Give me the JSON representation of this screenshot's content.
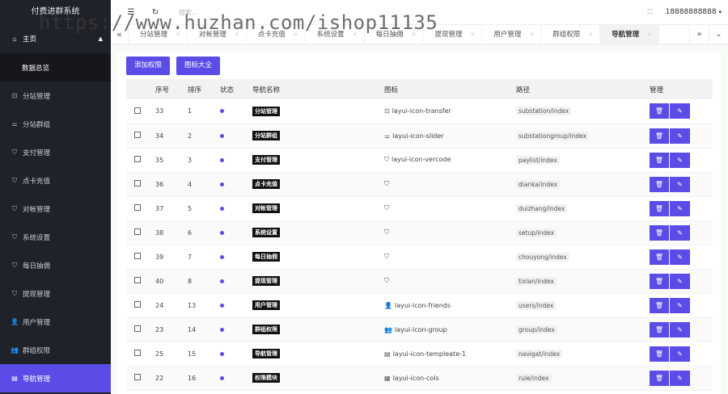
{
  "app": {
    "title": "付费进群系统"
  },
  "sidebar": {
    "items": [
      {
        "label": "主页",
        "icon": "⌂",
        "icon_name": "home-icon",
        "type": "home"
      },
      {
        "label": "数据总览",
        "icon": "",
        "icon_name": "",
        "type": "sub"
      },
      {
        "label": "分站管理",
        "icon": "⊡",
        "icon_name": "transfer-icon",
        "type": "item"
      },
      {
        "label": "分站群组",
        "icon": "⚌",
        "icon_name": "slider-icon",
        "type": "item"
      },
      {
        "label": "支付管理",
        "icon": "⛉",
        "icon_name": "shield-icon",
        "type": "item"
      },
      {
        "label": "点卡充值",
        "icon": "⛉",
        "icon_name": "shield-icon",
        "type": "item"
      },
      {
        "label": "对帐管理",
        "icon": "⛉",
        "icon_name": "shield-icon",
        "type": "item"
      },
      {
        "label": "系统设置",
        "icon": "⛉",
        "icon_name": "shield-icon",
        "type": "item"
      },
      {
        "label": "每日抽佣",
        "icon": "⛉",
        "icon_name": "shield-icon",
        "type": "item"
      },
      {
        "label": "提现管理",
        "icon": "⛉",
        "icon_name": "shield-icon",
        "type": "item"
      },
      {
        "label": "用户管理",
        "icon": "👤",
        "icon_name": "user-icon",
        "type": "item"
      },
      {
        "label": "群组权限",
        "icon": "👥",
        "icon_name": "group-icon",
        "type": "item"
      },
      {
        "label": "导航管理",
        "icon": "▤",
        "icon_name": "template-icon",
        "type": "active"
      }
    ]
  },
  "header": {
    "search_placeholder": "搜索...",
    "phone": "18888888888"
  },
  "watermark": "https://www.huzhan.com/ishop11135",
  "tabs": [
    {
      "label": "分站管理",
      "active": false
    },
    {
      "label": "对帐管理",
      "active": false
    },
    {
      "label": "点卡充值",
      "active": false
    },
    {
      "label": "系统设置",
      "active": false
    },
    {
      "label": "每日抽佣",
      "active": false
    },
    {
      "label": "提现管理",
      "active": false
    },
    {
      "label": "用户管理",
      "active": false
    },
    {
      "label": "群组权限",
      "active": false
    },
    {
      "label": "导航管理",
      "active": true
    }
  ],
  "toolbar": {
    "add_label": "添加权限",
    "icons_label": "图标大全"
  },
  "table": {
    "headers": [
      "",
      "序号",
      "排序",
      "状态",
      "导航名称",
      "图标",
      "路径",
      "管理"
    ],
    "rows": [
      {
        "id": "33",
        "sort": "1",
        "name": "分站管理",
        "icon_glyph": "⊡",
        "icon_name": "transfer-icon",
        "icon_text": "layui-icon-transfer",
        "path": "substation/index"
      },
      {
        "id": "34",
        "sort": "2",
        "name": "分站群组",
        "icon_glyph": "⚌",
        "icon_name": "slider-icon",
        "icon_text": "layui-icon-slider",
        "path": "substationgroup/index"
      },
      {
        "id": "35",
        "sort": "3",
        "name": "支付管理",
        "icon_glyph": "⛉",
        "icon_name": "shield-icon",
        "icon_text": "layui-icon-vercode",
        "path": "paylist/index"
      },
      {
        "id": "36",
        "sort": "4",
        "name": "点卡充值",
        "icon_glyph": "⛉",
        "icon_name": "shield-icon",
        "icon_text": "",
        "path": "dianka/index"
      },
      {
        "id": "37",
        "sort": "5",
        "name": "对帐管理",
        "icon_glyph": "⛉",
        "icon_name": "shield-icon",
        "icon_text": "",
        "path": "duizhang/index"
      },
      {
        "id": "38",
        "sort": "6",
        "name": "系统设置",
        "icon_glyph": "⛉",
        "icon_name": "shield-icon",
        "icon_text": "",
        "path": "setup/index"
      },
      {
        "id": "39",
        "sort": "7",
        "name": "每日抽佣",
        "icon_glyph": "⛉",
        "icon_name": "shield-icon",
        "icon_text": "",
        "path": "chouyong/index"
      },
      {
        "id": "40",
        "sort": "8",
        "name": "提现管理",
        "icon_glyph": "⛉",
        "icon_name": "shield-icon",
        "icon_text": "",
        "path": "tixian/index"
      },
      {
        "id": "24",
        "sort": "13",
        "name": "用户管理",
        "icon_glyph": "👤",
        "icon_name": "user-icon",
        "icon_text": "layui-icon-friends",
        "path": "users/index"
      },
      {
        "id": "23",
        "sort": "14",
        "name": "群组权限",
        "icon_glyph": "👥",
        "icon_name": "group-icon",
        "icon_text": "layui-icon-group",
        "path": "group/index"
      },
      {
        "id": "25",
        "sort": "15",
        "name": "导航管理",
        "icon_glyph": "▤",
        "icon_name": "template-icon",
        "icon_text": "layui-icon-templeate-1",
        "path": "navigat/index"
      },
      {
        "id": "22",
        "sort": "16",
        "name": "权限模块",
        "icon_glyph": "▦",
        "icon_name": "cols-icon",
        "icon_text": "layui-icon-cols",
        "path": "rule/index"
      }
    ]
  },
  "colors": {
    "accent": "#5b4ce8",
    "sidebar_bg": "#20222a"
  }
}
